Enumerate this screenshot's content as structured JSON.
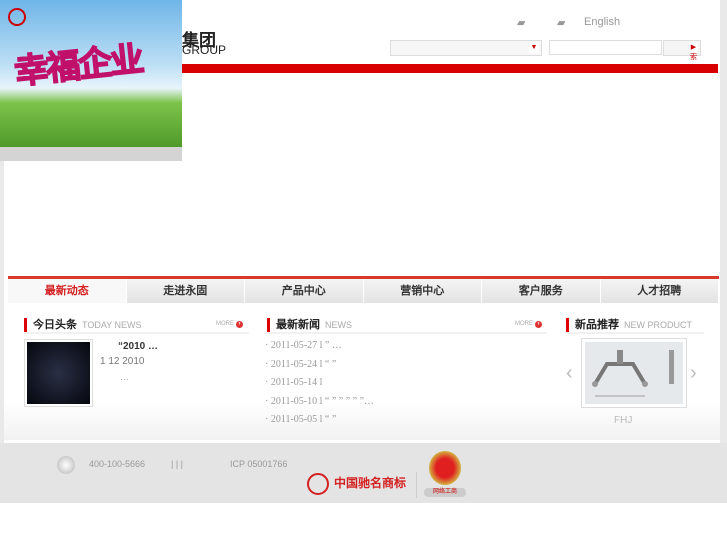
{
  "header": {
    "banner_slogan": "幸福企业",
    "logo_text": "集团",
    "logo_en": "GROUP",
    "lang_english": "English",
    "search_button": "搜索"
  },
  "nav": [
    {
      "label": "最新动态",
      "active": true
    },
    {
      "label": "走进永固"
    },
    {
      "label": "产品中心"
    },
    {
      "label": "营销中心"
    },
    {
      "label": "客户服务"
    },
    {
      "label": "人才招聘"
    }
  ],
  "today": {
    "title": "今日头条",
    "en": "TODAY NEWS",
    "more": "MORE",
    "headline": "“2010                    …",
    "date": "1 12 2010",
    "excerpt": "…"
  },
  "news": {
    "title": "最新新闻",
    "en": "NEWS",
    "more": "MORE",
    "items": [
      "2011-05-27 l          ”      …",
      "2011-05-24 l     “     ”",
      "2011-05-14 l",
      "2011-05-10 l “   ” ”   ” ” ”…",
      "2011-05-05 l          “  ”"
    ]
  },
  "product": {
    "title": "新品推荐",
    "en": "NEW PRODUCT",
    "name": "FHJ"
  },
  "footer": {
    "phone": "400-100-5666",
    "links": "|    |    |",
    "icp": "ICP 05001766",
    "brand": "中国驰名商标",
    "badge": "网络工商"
  }
}
